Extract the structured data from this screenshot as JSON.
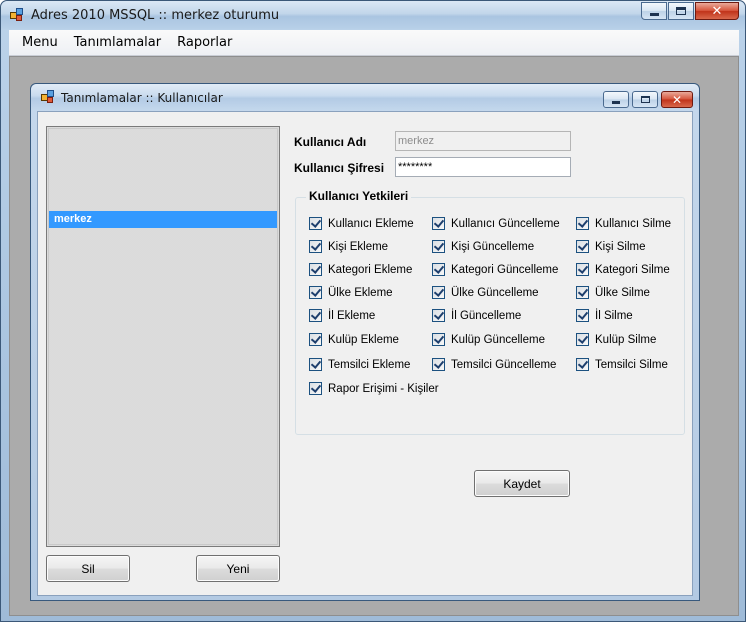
{
  "window": {
    "title": "Adres 2010 MSSQL :: merkez oturumu",
    "close_glyph": "✕"
  },
  "menu": {
    "items": [
      "Menu",
      "Tanımlamalar",
      "Raporlar"
    ]
  },
  "child_window": {
    "title": "Tanımlamalar :: Kullanıcılar",
    "close_glyph": "✕"
  },
  "user_list": {
    "selected_item": "merkez"
  },
  "buttons": {
    "delete_label": "Sil",
    "new_label": "Yeni",
    "save_label": "Kaydet"
  },
  "form": {
    "username_label": "Kullanıcı Adı",
    "username_value": "merkez",
    "password_label": "Kullanıcı Şifresi",
    "password_value": "********"
  },
  "permissions": {
    "group_title": "Kullanıcı Yetkileri",
    "items": [
      {
        "label": "Kullanıcı Ekleme",
        "checked": true
      },
      {
        "label": "Kullanıcı Güncelleme",
        "checked": true
      },
      {
        "label": "Kullanıcı Silme",
        "checked": true
      },
      {
        "label": "Kişi Ekleme",
        "checked": true
      },
      {
        "label": "Kişi Güncelleme",
        "checked": true
      },
      {
        "label": "Kişi Silme",
        "checked": true
      },
      {
        "label": "Kategori Ekleme",
        "checked": true
      },
      {
        "label": "Kategori Güncelleme",
        "checked": true
      },
      {
        "label": "Kategori Silme",
        "checked": true
      },
      {
        "label": "Ülke Ekleme",
        "checked": true
      },
      {
        "label": "Ülke Güncelleme",
        "checked": true
      },
      {
        "label": "Ülke Silme",
        "checked": true
      },
      {
        "label": "İl Ekleme",
        "checked": true
      },
      {
        "label": "İl Güncelleme",
        "checked": true
      },
      {
        "label": "İl Silme",
        "checked": true
      },
      {
        "label": "Kulüp Ekleme",
        "checked": true
      },
      {
        "label": "Kulüp Güncelleme",
        "checked": true
      },
      {
        "label": "Kulüp Silme",
        "checked": true
      },
      {
        "label": "Temsilci Ekleme",
        "checked": true
      },
      {
        "label": "Temsilci Güncelleme",
        "checked": true
      },
      {
        "label": "Temsilci Silme",
        "checked": true
      },
      {
        "label": "Rapor Erişimi - Kişiler",
        "checked": true
      }
    ]
  }
}
